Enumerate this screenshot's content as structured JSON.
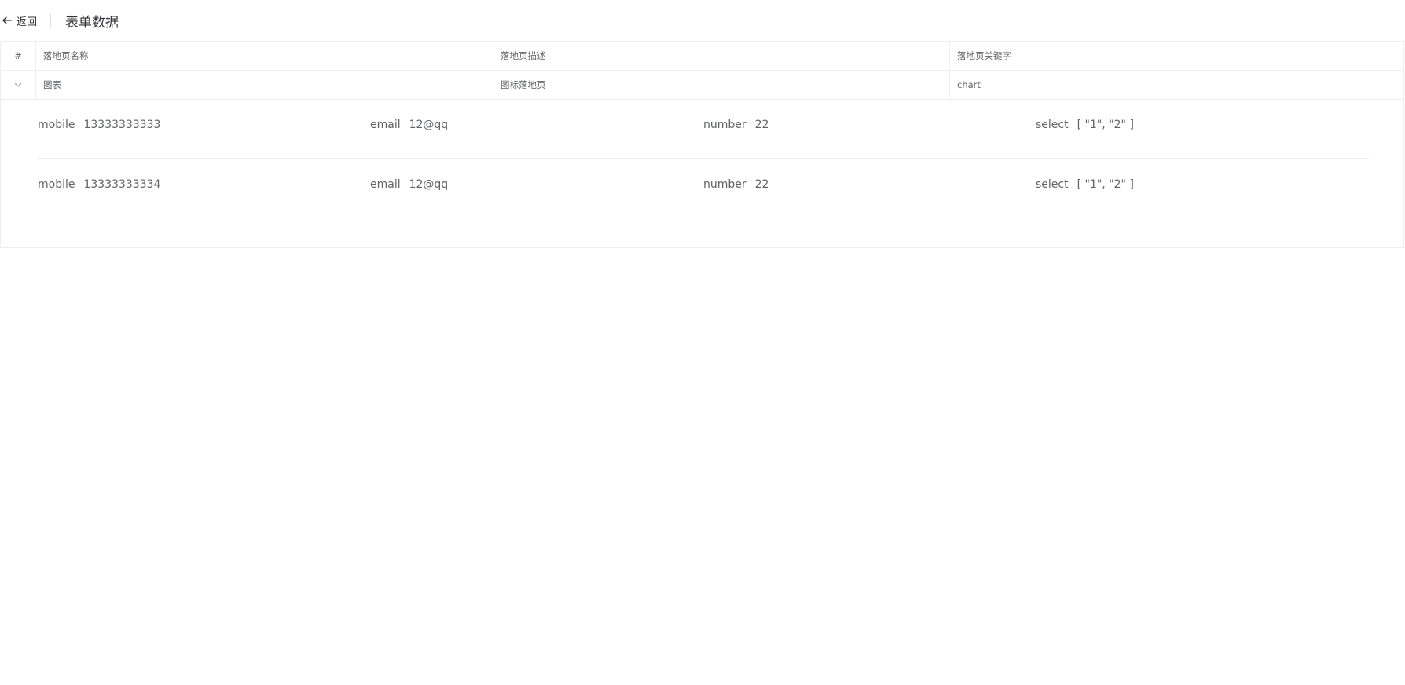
{
  "header": {
    "back_label": "返回",
    "title": "表单数据"
  },
  "table": {
    "columns": {
      "index": "#",
      "name": "落地页名称",
      "description": "落地页描述",
      "keywords": "落地页关键字"
    },
    "row": {
      "name": "图表",
      "description": "图标落地页",
      "keywords": "chart"
    },
    "details": [
      {
        "mobile_label": "mobile",
        "mobile": "13333333333",
        "email_label": "email",
        "email": "12@qq",
        "number_label": "number",
        "number": "22",
        "select_label": "select",
        "select": "[ \"1\", \"2\" ]"
      },
      {
        "mobile_label": "mobile",
        "mobile": "13333333334",
        "email_label": "email",
        "email": "12@qq",
        "number_label": "number",
        "number": "22",
        "select_label": "select",
        "select": "[ \"1\", \"2\" ]"
      }
    ]
  },
  "icons": {
    "back": "arrow-left-icon",
    "expand": "chevron-down-icon"
  }
}
